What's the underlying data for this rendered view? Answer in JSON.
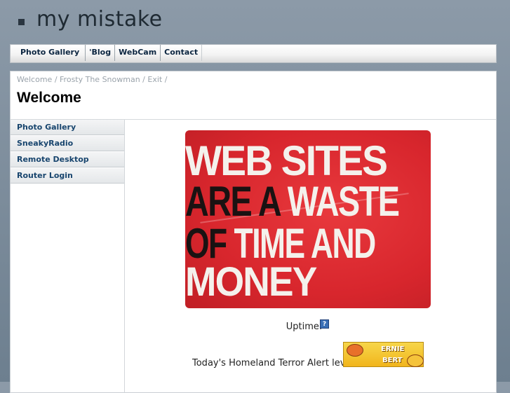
{
  "site": {
    "title": "my mistake"
  },
  "top_nav": [
    "Photo Gallery",
    "'Blog",
    "WebCam",
    "Contact"
  ],
  "breadcrumb": [
    "Welcome",
    "Frosty The Snowman",
    "Exit"
  ],
  "page": {
    "title": "Welcome"
  },
  "sidebar": [
    "Photo Gallery",
    "SneakyRadio",
    "Remote Desktop",
    "Router Login"
  ],
  "banner": {
    "line1": "WEB SITES",
    "line2_dark": "ARE A",
    "line2_light": " WASTE",
    "line3_dark": "OF",
    "line3_light": " TIME AND",
    "line4": "MONEY"
  },
  "uptime": {
    "label": "Uptime:",
    "icon": "?"
  },
  "terror_alert": {
    "label": "Today's Homeland Terror Alert level:",
    "badge_line1": "ERNIE",
    "badge_line2": "BERT"
  },
  "colors": {
    "accent": "#18456e",
    "banner_red": "#d8262d"
  }
}
